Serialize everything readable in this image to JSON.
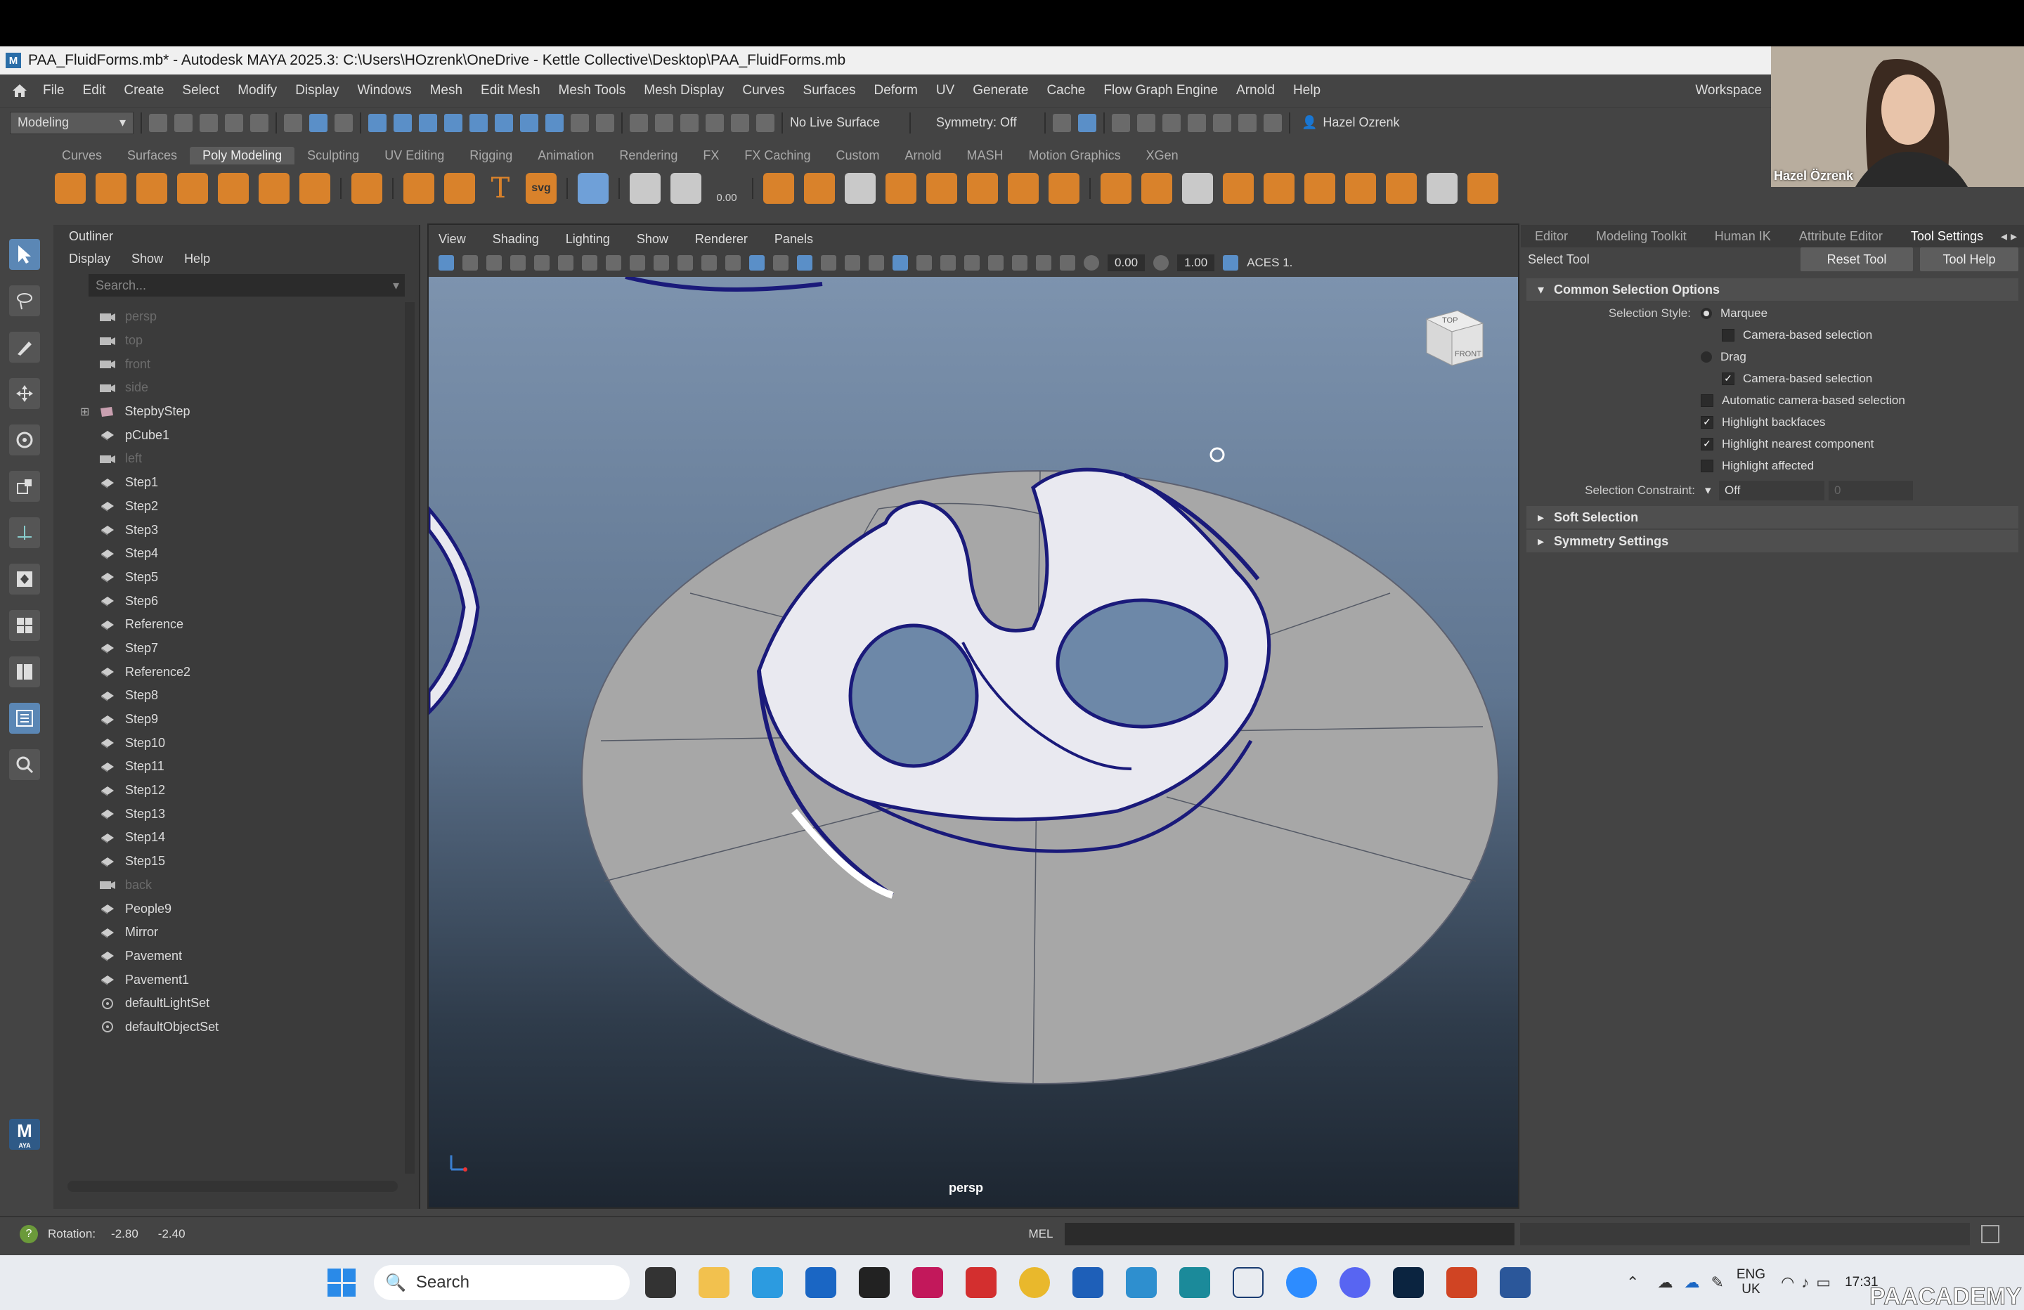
{
  "window": {
    "title": "PAA_FluidForms.mb* - Autodesk MAYA 2025.3: C:\\Users\\HOzrenk\\OneDrive - Kettle Collective\\Desktop\\PAA_FluidForms.mb"
  },
  "menubar": {
    "items": [
      "File",
      "Edit",
      "Create",
      "Select",
      "Modify",
      "Display",
      "Windows",
      "Mesh",
      "Edit Mesh",
      "Mesh Tools",
      "Mesh Display",
      "Curves",
      "Surfaces",
      "Deform",
      "UV",
      "Generate",
      "Cache",
      "Flow Graph Engine",
      "Arnold",
      "Help"
    ],
    "workspace": "Workspace"
  },
  "statusline": {
    "mode": "Modeling",
    "live_surface": "No Live Surface",
    "symmetry": "Symmetry: Off",
    "user": "Hazel Ozrenk"
  },
  "shelf": {
    "tabs": [
      "Curves",
      "Surfaces",
      "Poly Modeling",
      "Sculpting",
      "UV Editing",
      "Rigging",
      "Animation",
      "Rendering",
      "FX",
      "FX Caching",
      "Custom",
      "Arnold",
      "MASH",
      "Motion Graphics",
      "XGen"
    ],
    "active_tab": "Poly Modeling",
    "svg_label": "svg",
    "zero_label": "0.00"
  },
  "outliner": {
    "title": "Outliner",
    "menu": [
      "Display",
      "Show",
      "Help"
    ],
    "search_placeholder": "Search...",
    "items": [
      {
        "name": "persp",
        "dim": true,
        "icon": "camera"
      },
      {
        "name": "top",
        "dim": true,
        "icon": "camera"
      },
      {
        "name": "front",
        "dim": true,
        "icon": "camera"
      },
      {
        "name": "side",
        "dim": true,
        "icon": "camera"
      },
      {
        "name": "StepbyStep",
        "dim": false,
        "icon": "group"
      },
      {
        "name": "pCube1",
        "dim": false,
        "icon": "mesh"
      },
      {
        "name": "left",
        "dim": true,
        "icon": "camera"
      },
      {
        "name": "Step1",
        "dim": false,
        "icon": "mesh"
      },
      {
        "name": "Step2",
        "dim": false,
        "icon": "mesh"
      },
      {
        "name": "Step3",
        "dim": false,
        "icon": "mesh"
      },
      {
        "name": "Step4",
        "dim": false,
        "icon": "mesh"
      },
      {
        "name": "Step5",
        "dim": false,
        "icon": "mesh"
      },
      {
        "name": "Step6",
        "dim": false,
        "icon": "mesh"
      },
      {
        "name": "Reference",
        "dim": false,
        "icon": "mesh"
      },
      {
        "name": "Step7",
        "dim": false,
        "icon": "mesh"
      },
      {
        "name": "Reference2",
        "dim": false,
        "icon": "mesh"
      },
      {
        "name": "Step8",
        "dim": false,
        "icon": "mesh"
      },
      {
        "name": "Step9",
        "dim": false,
        "icon": "mesh"
      },
      {
        "name": "Step10",
        "dim": false,
        "icon": "mesh"
      },
      {
        "name": "Step11",
        "dim": false,
        "icon": "mesh"
      },
      {
        "name": "Step12",
        "dim": false,
        "icon": "mesh"
      },
      {
        "name": "Step13",
        "dim": false,
        "icon": "mesh"
      },
      {
        "name": "Step14",
        "dim": false,
        "icon": "mesh"
      },
      {
        "name": "Step15",
        "dim": false,
        "icon": "mesh"
      },
      {
        "name": "back",
        "dim": true,
        "icon": "camera"
      },
      {
        "name": "People9",
        "dim": false,
        "icon": "mesh"
      },
      {
        "name": "Mirror",
        "dim": false,
        "icon": "mesh"
      },
      {
        "name": "Pavement",
        "dim": false,
        "icon": "mesh"
      },
      {
        "name": "Pavement1",
        "dim": false,
        "icon": "mesh"
      },
      {
        "name": "defaultLightSet",
        "dim": false,
        "icon": "set"
      },
      {
        "name": "defaultObjectSet",
        "dim": false,
        "icon": "set"
      }
    ]
  },
  "viewport": {
    "menu": [
      "View",
      "Shading",
      "Lighting",
      "Show",
      "Renderer",
      "Panels"
    ],
    "exposure": "0.00",
    "gamma": "1.00",
    "color_space": "ACES 1.",
    "camera": "persp",
    "viewcube_top": "TOP",
    "viewcube_front": "FRONT"
  },
  "right_panel": {
    "tabs": [
      "Editor",
      "Modeling Toolkit",
      "Human IK",
      "Attribute Editor",
      "Tool Settings"
    ],
    "active_tab": "Tool Settings",
    "tool_name": "Select Tool",
    "reset_button": "Reset Tool",
    "help_button": "Tool Help",
    "section_common": "Common Selection Options",
    "selection_style_label": "Selection Style:",
    "marquee": "Marquee",
    "camera_based_1": "Camera-based selection",
    "drag": "Drag",
    "camera_based_2": "Camera-based selection",
    "auto_camera": "Automatic camera-based selection",
    "highlight_backfaces": "Highlight backfaces",
    "highlight_nearest": "Highlight nearest component",
    "highlight_affected": "Highlight affected",
    "constraint_label": "Selection Constraint:",
    "constraint_value": "Off",
    "constraint_num": "0",
    "section_soft": "Soft Selection",
    "section_symmetry": "Symmetry Settings"
  },
  "helpline": {
    "label": "Rotation:",
    "x": "-2.80",
    "y": "-2.40",
    "mel": "MEL"
  },
  "webcam": {
    "name": "Hazel Özrenk"
  },
  "taskbar": {
    "search": "Search",
    "lang": "ENG",
    "region": "UK",
    "time": "17:31",
    "watermark": "PAACADEMY",
    "apps": [
      "task-view",
      "file-explorer",
      "edge",
      "outlook",
      "inkscape",
      "indesign",
      "acrobat",
      "chrome",
      "revit",
      "maya",
      "3dsmax",
      "arc",
      "zoom",
      "discord",
      "photoshop",
      "powerpoint",
      "word"
    ]
  },
  "colors": {
    "bg": "#444444",
    "selected_tool": "#5b87b5",
    "curve": "#1a1a7a",
    "plane": "#a7a7a7"
  }
}
